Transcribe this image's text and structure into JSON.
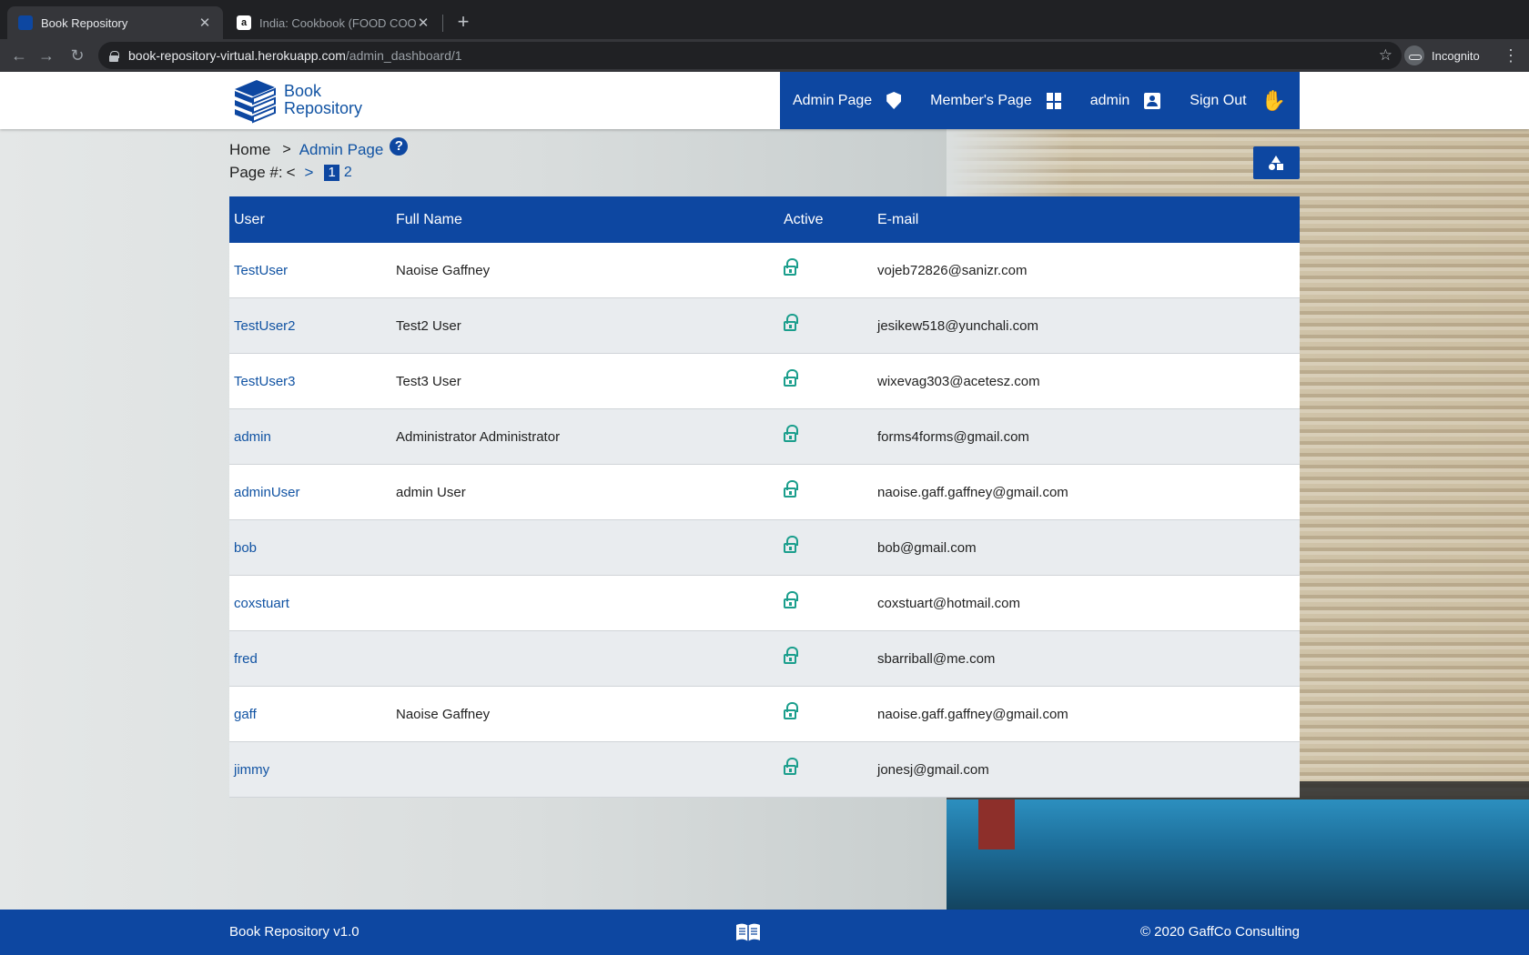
{
  "browser": {
    "tabs": [
      {
        "title": "Book Repository",
        "active": true
      },
      {
        "title": "India: Cookbook (FOOD COOK",
        "active": false
      }
    ],
    "url_host": "book-repository-virtual.herokuapp.com",
    "url_path": "/admin_dashboard/1",
    "profile_label": "Incognito"
  },
  "header": {
    "logo_line1": "Book",
    "logo_line2": "Repository",
    "nav": {
      "admin_page": "Admin Page",
      "members_page": "Member's Page",
      "user": "admin",
      "sign_out": "Sign Out"
    },
    "nav_icons": [
      "shield-account-icon",
      "dashboard-icon",
      "contact-card-icon",
      "wave-hand-icon"
    ]
  },
  "breadcrumb": {
    "home": "Home",
    "separator": ">",
    "current": "Admin Page",
    "help": "?"
  },
  "pagination": {
    "label": "Page #:",
    "prev": "<",
    "next": ">",
    "current": "1",
    "other": "2"
  },
  "table": {
    "headers": {
      "user": "User",
      "full_name": "Full Name",
      "active": "Active",
      "email": "E-mail"
    },
    "rows": [
      {
        "user": "TestUser",
        "full_name": "Naoise Gaffney",
        "email": "vojeb72826@sanizr.com"
      },
      {
        "user": "TestUser2",
        "full_name": "Test2 User",
        "email": "jesikew518@yunchali.com"
      },
      {
        "user": "TestUser3",
        "full_name": "Test3 User",
        "email": "wixevag303@acetesz.com"
      },
      {
        "user": "admin",
        "full_name": "Administrator Administrator",
        "email": "forms4forms@gmail.com"
      },
      {
        "user": "adminUser",
        "full_name": "admin User",
        "email": "naoise.gaff.gaffney@gmail.com"
      },
      {
        "user": "bob",
        "full_name": "",
        "email": "bob@gmail.com"
      },
      {
        "user": "coxstuart",
        "full_name": "",
        "email": "coxstuart@hotmail.com"
      },
      {
        "user": "fred",
        "full_name": "",
        "email": "sbarriball@me.com"
      },
      {
        "user": "gaff",
        "full_name": "Naoise Gaffney",
        "email": "naoise.gaff.gaffney@gmail.com"
      },
      {
        "user": "jimmy",
        "full_name": "",
        "email": "jonesj@gmail.com"
      }
    ]
  },
  "footer": {
    "version": "Book Repository v1.0",
    "copyright": "© 2020 GaffCo Consulting"
  },
  "colors": {
    "brand_blue": "#0d47a1",
    "link_blue": "#1153a3",
    "active_lock": "#1a9e8c"
  }
}
